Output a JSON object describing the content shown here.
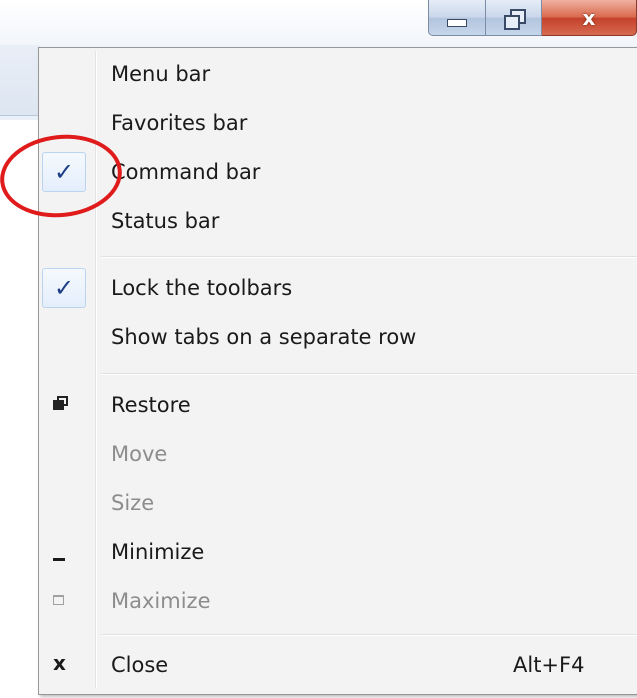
{
  "window": {
    "caption_buttons": {
      "minimize_icon": "minimize-glyph",
      "maximize_icon": "restore-down-glyph",
      "close_icon": "x-glyph",
      "close_color": "#c4412a"
    }
  },
  "menu": {
    "toolbar_items": [
      {
        "label": "Menu bar",
        "checked": false
      },
      {
        "label": "Favorites bar",
        "checked": false
      },
      {
        "label": "Command bar",
        "checked": true
      },
      {
        "label": "Status bar",
        "checked": false
      }
    ],
    "toolbar_options": [
      {
        "label": "Lock the toolbars",
        "checked": true
      },
      {
        "label": "Show tabs on a separate row",
        "checked": false
      }
    ],
    "window_items": [
      {
        "label": "Restore",
        "enabled": true,
        "icon": "restore-icon"
      },
      {
        "label": "Move",
        "enabled": false
      },
      {
        "label": "Size",
        "enabled": false
      },
      {
        "label": "Minimize",
        "enabled": true,
        "icon": "minimize-icon"
      },
      {
        "label": "Maximize",
        "enabled": false,
        "icon": "maximize-icon"
      }
    ],
    "close_item": {
      "label": "Close",
      "shortcut": "Alt+F4",
      "icon": "close-icon"
    },
    "check_glyph": "✓",
    "close_glyph": "x"
  },
  "annotation": {
    "color": "#e01b1b",
    "target": "Command bar check mark"
  }
}
